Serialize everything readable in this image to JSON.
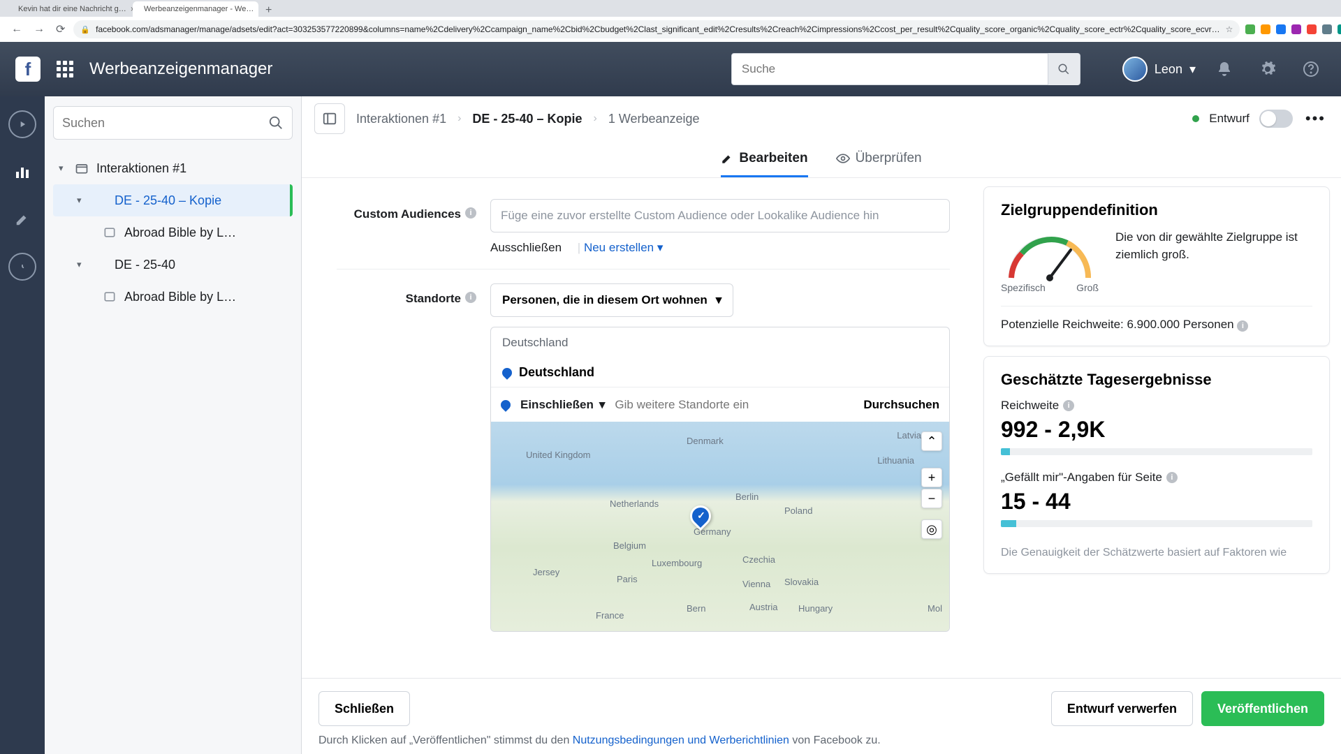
{
  "browser": {
    "tabs": [
      {
        "title": "Kevin hat dir eine Nachricht g…"
      },
      {
        "title": "Werbeanzeigenmanager - We…"
      }
    ],
    "url": "facebook.com/adsmanager/manage/adsets/edit?act=303253577220899&columns=name%2Cdelivery%2Ccampaign_name%2Cbid%2Cbudget%2Clast_significant_edit%2Cresults%2Creach%2Cimpressions%2Ccost_per_result%2Cquality_score_organic%2Cquality_score_ectr%2Cquality_score_ecvr…"
  },
  "header": {
    "title": "Werbeanzeigenmanager",
    "search_placeholder": "Suche",
    "user": "Leon"
  },
  "sidebar": {
    "search_placeholder": "Suchen",
    "items": {
      "campaign": "Interaktionen #1",
      "adset1": "DE - 25-40 – Kopie",
      "ad1": "Abroad Bible by L…",
      "adset2": "DE - 25-40",
      "ad2": "Abroad Bible by L…"
    }
  },
  "breadcrumb": {
    "a": "Interaktionen #1",
    "b": "DE - 25-40 – Kopie",
    "c": "1 Werbeanzeige",
    "status": "Entwurf"
  },
  "tabs": {
    "edit": "Bearbeiten",
    "review": "Überprüfen"
  },
  "form": {
    "custom_audiences_label": "Custom Audiences",
    "custom_audiences_placeholder": "Füge eine zuvor erstellte Custom Audience oder Lookalike Audience hin",
    "exclude": "Ausschließen",
    "create_new": "Neu erstellen",
    "locations_label": "Standorte",
    "location_mode": "Personen, die in diesem Ort wohnen",
    "country_group": "Deutschland",
    "country_item": "Deutschland",
    "include": "Einschließen",
    "loc_input_placeholder": "Gib weitere Standorte ein",
    "browse": "Durchsuchen"
  },
  "map_labels": {
    "uk": "United Kingdom",
    "denmark": "Denmark",
    "latvia": "Latvia",
    "lithuania": "Lithuania",
    "netherlands": "Netherlands",
    "berlin": "Berlin",
    "poland": "Poland",
    "germany": "Germany",
    "belgium": "Belgium",
    "luxembourg": "Luxembourg",
    "czechia": "Czechia",
    "jersey": "Jersey",
    "paris": "Paris",
    "vienna": "Vienna",
    "slovakia": "Slovakia",
    "france": "France",
    "bern": "Bern",
    "austria": "Austria",
    "hungary": "Hungary",
    "mol": "Mol"
  },
  "audience_def": {
    "title": "Zielgruppendefinition",
    "spec": "Spezifisch",
    "broad": "Groß",
    "desc": "Die von dir gewählte Zielgruppe ist ziemlich groß.",
    "reach_line": "Potenzielle Reichweite: 6.900.000 Personen"
  },
  "daily": {
    "title": "Geschätzte Tagesergebnisse",
    "reach_label": "Reichweite",
    "reach_val": "992 - 2,9K",
    "likes_label": "„Gefällt mir\"-Angaben für Seite",
    "likes_val": "15 - 44",
    "reach_pct": 3,
    "likes_pct": 5,
    "cutoff": "Die Genauigkeit der Schätzwerte basiert auf Faktoren wie"
  },
  "footer": {
    "close": "Schließen",
    "discard": "Entwurf verwerfen",
    "publish": "Veröffentlichen",
    "note_a": "Durch Klicken auf „Veröffentlichen\" stimmst du den ",
    "note_link": "Nutzungsbedingungen und Werberichtlinien",
    "note_b": " von Facebook zu."
  }
}
